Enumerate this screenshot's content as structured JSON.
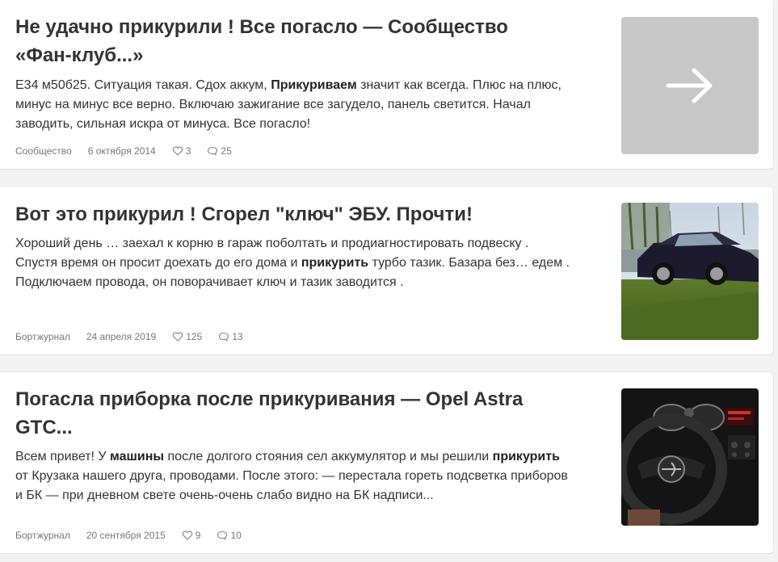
{
  "posts": [
    {
      "title": "Не удачно прикурили ! Все погасло — Сообщество «Фан-клуб...»",
      "excerpt": [
        {
          "text": "E34 м50б25. Ситуация такая. Сдох аккум, "
        },
        {
          "text": "Прикуриваем",
          "bold": true
        },
        {
          "text": " значит как всегда. Плюс на плюс, минус на минус все верно. Включаю зажигание все загудело, панель светится. Начал заводить, сильная искра от минуса. Все погасло!"
        }
      ],
      "category": "Сообщество",
      "date": "6 октября 2014",
      "likes": "3",
      "comments": "25",
      "thumb": "arrow-icon"
    },
    {
      "title": "Вот это прикурил ! Сгорел \"ключ\" ЭБУ. Прочти!",
      "excerpt": [
        {
          "text": "Хороший день … заехал к корню в гараж поболтать и продиагностировать подвеску . Спустя время он просит доехать до его дома и "
        },
        {
          "text": "прикурить",
          "bold": true
        },
        {
          "text": " турбо тазик. Базара без… едем . Подключаем провода, он поворачивает ключ и тазик заводится ."
        }
      ],
      "category": "Бортжурнал",
      "date": "24 апреля 2019",
      "likes": "125",
      "comments": "13",
      "thumb": "dark-sedan-photo"
    },
    {
      "title": "Погасла приборка после прикуривания — Opel Astra GTC...",
      "excerpt": [
        {
          "text": "Всем привет! У "
        },
        {
          "text": "машины",
          "bold": true
        },
        {
          "text": " после долгого стояния сел аккумулятор и мы решили "
        },
        {
          "text": "прикурить",
          "bold": true
        },
        {
          "text": " от Крузака нашего друга, проводами. После этого: — перестала гореть подсветка приборов и БК — при дневном свете очень-очень слабо видно на БК надписи..."
        }
      ],
      "category": "Бортжурнал",
      "date": "20 сентября 2015",
      "likes": "9",
      "comments": "10",
      "thumb": "car-dashboard-photo"
    }
  ]
}
